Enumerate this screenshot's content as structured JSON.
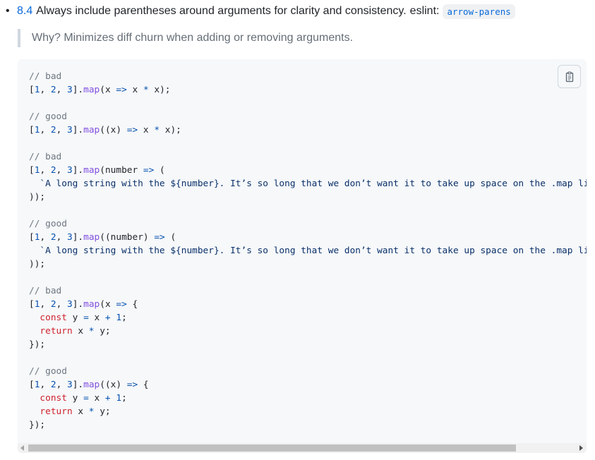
{
  "rule": {
    "bullet": "•",
    "number": "8.4",
    "text": "Always include parentheses around arguments for clarity and consistency.",
    "eslint_label": "eslint:",
    "eslint_rule": "arrow-parens"
  },
  "quote": {
    "text": "Why? Minimizes diff churn when adding or removing arguments."
  },
  "code": {
    "lines": [
      [
        [
          "c",
          "// bad"
        ]
      ],
      [
        [
          "p",
          "["
        ],
        [
          "n",
          "1"
        ],
        [
          "p",
          ", "
        ],
        [
          "n",
          "2"
        ],
        [
          "p",
          ", "
        ],
        [
          "n",
          "3"
        ],
        [
          "p",
          "]."
        ],
        [
          "f",
          "map"
        ],
        [
          "p",
          "(x "
        ],
        [
          "o",
          "=>"
        ],
        [
          "p",
          " x "
        ],
        [
          "o",
          "*"
        ],
        [
          "p",
          " x);"
        ]
      ],
      [],
      [
        [
          "c",
          "// good"
        ]
      ],
      [
        [
          "p",
          "["
        ],
        [
          "n",
          "1"
        ],
        [
          "p",
          ", "
        ],
        [
          "n",
          "2"
        ],
        [
          "p",
          ", "
        ],
        [
          "n",
          "3"
        ],
        [
          "p",
          "]."
        ],
        [
          "f",
          "map"
        ],
        [
          "p",
          "((x) "
        ],
        [
          "o",
          "=>"
        ],
        [
          "p",
          " x "
        ],
        [
          "o",
          "*"
        ],
        [
          "p",
          " x);"
        ]
      ],
      [],
      [
        [
          "c",
          "// bad"
        ]
      ],
      [
        [
          "p",
          "["
        ],
        [
          "n",
          "1"
        ],
        [
          "p",
          ", "
        ],
        [
          "n",
          "2"
        ],
        [
          "p",
          ", "
        ],
        [
          "n",
          "3"
        ],
        [
          "p",
          "]."
        ],
        [
          "f",
          "map"
        ],
        [
          "p",
          "(number "
        ],
        [
          "o",
          "=>"
        ],
        [
          "p",
          " ("
        ]
      ],
      [
        [
          "p",
          "  "
        ],
        [
          "s",
          "`A long string with the ${number}. It’s so long that we don’t want it to take up space on the .map line!`"
        ]
      ],
      [
        [
          "p",
          "));"
        ]
      ],
      [],
      [
        [
          "c",
          "// good"
        ]
      ],
      [
        [
          "p",
          "["
        ],
        [
          "n",
          "1"
        ],
        [
          "p",
          ", "
        ],
        [
          "n",
          "2"
        ],
        [
          "p",
          ", "
        ],
        [
          "n",
          "3"
        ],
        [
          "p",
          "]."
        ],
        [
          "f",
          "map"
        ],
        [
          "p",
          "((number) "
        ],
        [
          "o",
          "=>"
        ],
        [
          "p",
          " ("
        ]
      ],
      [
        [
          "p",
          "  "
        ],
        [
          "s",
          "`A long string with the ${number}. It’s so long that we don’t want it to take up space on the .map line!`"
        ]
      ],
      [
        [
          "p",
          "));"
        ]
      ],
      [],
      [
        [
          "c",
          "// bad"
        ]
      ],
      [
        [
          "p",
          "["
        ],
        [
          "n",
          "1"
        ],
        [
          "p",
          ", "
        ],
        [
          "n",
          "2"
        ],
        [
          "p",
          ", "
        ],
        [
          "n",
          "3"
        ],
        [
          "p",
          "]."
        ],
        [
          "f",
          "map"
        ],
        [
          "p",
          "(x "
        ],
        [
          "o",
          "=>"
        ],
        [
          "p",
          " {"
        ]
      ],
      [
        [
          "p",
          "  "
        ],
        [
          "k",
          "const"
        ],
        [
          "p",
          " y "
        ],
        [
          "o",
          "="
        ],
        [
          "p",
          " x "
        ],
        [
          "o",
          "+"
        ],
        [
          "p",
          " "
        ],
        [
          "n",
          "1"
        ],
        [
          "p",
          ";"
        ]
      ],
      [
        [
          "p",
          "  "
        ],
        [
          "k",
          "return"
        ],
        [
          "p",
          " x "
        ],
        [
          "o",
          "*"
        ],
        [
          "p",
          " y;"
        ]
      ],
      [
        [
          "p",
          "});"
        ]
      ],
      [],
      [
        [
          "c",
          "// good"
        ]
      ],
      [
        [
          "p",
          "["
        ],
        [
          "n",
          "1"
        ],
        [
          "p",
          ", "
        ],
        [
          "n",
          "2"
        ],
        [
          "p",
          ", "
        ],
        [
          "n",
          "3"
        ],
        [
          "p",
          "]."
        ],
        [
          "f",
          "map"
        ],
        [
          "p",
          "((x) "
        ],
        [
          "o",
          "=>"
        ],
        [
          "p",
          " {"
        ]
      ],
      [
        [
          "p",
          "  "
        ],
        [
          "k",
          "const"
        ],
        [
          "p",
          " y "
        ],
        [
          "o",
          "="
        ],
        [
          "p",
          " x "
        ],
        [
          "o",
          "+"
        ],
        [
          "p",
          " "
        ],
        [
          "n",
          "1"
        ],
        [
          "p",
          ";"
        ]
      ],
      [
        [
          "p",
          "  "
        ],
        [
          "k",
          "return"
        ],
        [
          "p",
          " x "
        ],
        [
          "o",
          "*"
        ],
        [
          "p",
          " y;"
        ]
      ],
      [
        [
          "p",
          "});"
        ]
      ]
    ]
  },
  "icons": {
    "copy": "clipboard-icon",
    "scroll_left": "scroll-left-arrow-icon",
    "scroll_right": "scroll-right-arrow-icon"
  },
  "colors": {
    "link": "#0969da",
    "comment": "#6e7781",
    "number": "#0550ae",
    "function": "#8250df",
    "keyword": "#cf222e",
    "string": "#0a3069",
    "code_bg": "#f6f8fa"
  }
}
